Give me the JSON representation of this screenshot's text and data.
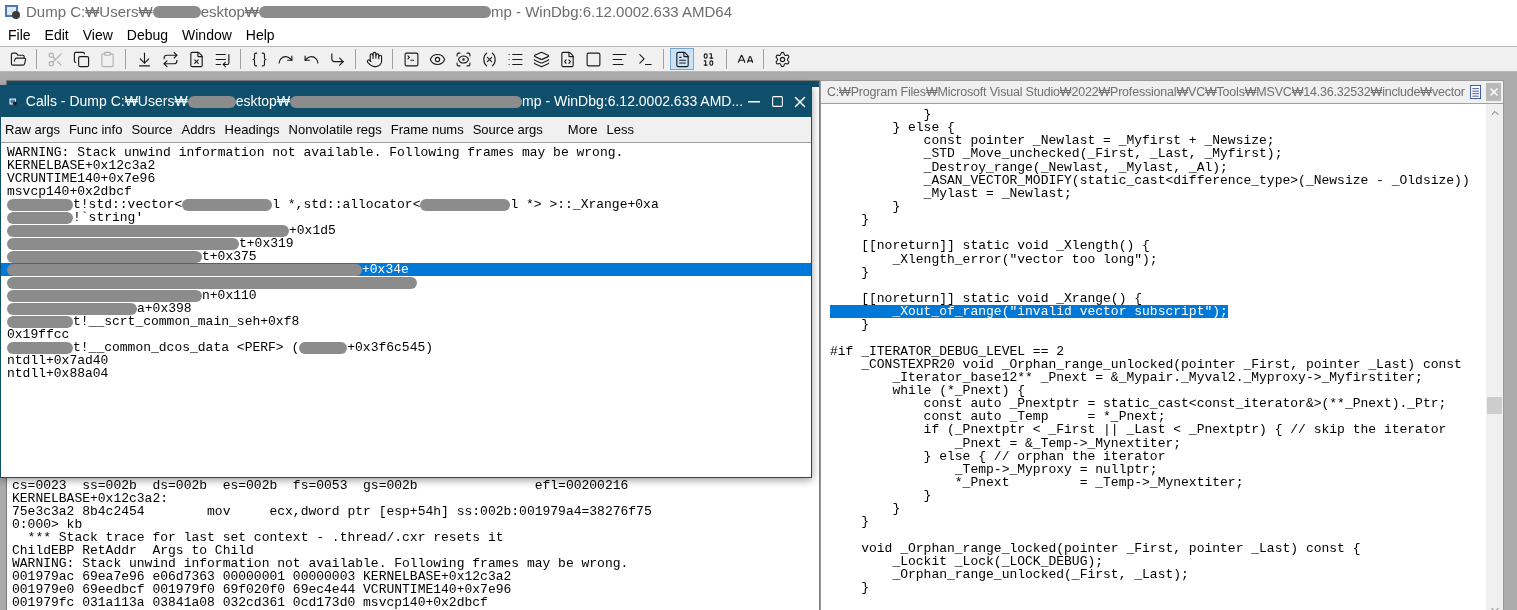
{
  "window": {
    "title": [
      {
        "kind": "text",
        "text": "Dump C:₩Users₩"
      },
      {
        "kind": "redacted"
      },
      {
        "kind": "text",
        "text": "esktop₩"
      },
      {
        "kind": "redacted"
      },
      {
        "kind": "text",
        "text": "mp - WinDbg:6.12.0002.633 AMD64"
      }
    ]
  },
  "menu": [
    "File",
    "Edit",
    "View",
    "Debug",
    "Window",
    "Help"
  ],
  "toolbar": [
    {
      "pressed": false,
      "disabled": false
    },
    {
      "pressed": false,
      "disabled": true
    },
    {
      "pressed": false,
      "disabled": false
    },
    {
      "pressed": false,
      "disabled": true
    },
    {
      "pressed": false,
      "disabled": false
    },
    {
      "pressed": false,
      "disabled": false
    },
    {
      "pressed": false,
      "disabled": false
    },
    {
      "pressed": false,
      "disabled": false
    },
    {
      "pressed": false,
      "disabled": false
    },
    {
      "pressed": false,
      "disabled": false
    },
    {
      "pressed": false,
      "disabled": false
    },
    {
      "pressed": false,
      "disabled": false
    },
    {
      "pressed": false,
      "disabled": false
    },
    {
      "pressed": false,
      "disabled": false
    },
    {
      "pressed": false,
      "disabled": false
    },
    {
      "pressed": false,
      "disabled": false
    },
    {
      "pressed": false,
      "disabled": false
    },
    {
      "pressed": false,
      "disabled": false
    },
    {
      "pressed": false,
      "disabled": false
    },
    {
      "pressed": false,
      "disabled": false
    },
    {
      "pressed": false,
      "disabled": false
    },
    {
      "pressed": false,
      "disabled": false
    },
    {
      "pressed": false,
      "disabled": false
    },
    {
      "pressed": true,
      "disabled": false
    },
    {
      "pressed": false,
      "disabled": false
    },
    {
      "pressed": false,
      "disabled": false
    },
    {
      "pressed": false,
      "disabled": false
    }
  ],
  "command_window": {
    "lines": [
      "cs=0023  ss=002b  ds=002b  es=002b  fs=0053  gs=002b               efl=00200216",
      "KERNELBASE+0x12c3a2:",
      "75e3c3a2 8b4c2454        mov     ecx,dword ptr [esp+54h] ss:002b:001979a4=38276f75",
      "0:000> kb",
      "  *** Stack trace for last set context - .thread/.cxr resets it",
      "ChildEBP RetAddr  Args to Child",
      "WARNING: Stack unwind information not available. Following frames may be wrong.",
      "001979ac 69ea7e96 e06d7363 00000001 00000003 KERNELBASE+0x12c3a2",
      "001979e0 69eedbcf 001979f0 69f020f0 69ec4e44 VCRUNTIME140+0x7e96",
      "001979fc 031a113a 03841a08 032cd361 0cd173d0 msvcp140+0x2dbcf"
    ]
  },
  "calls_window": {
    "title": [
      {
        "kind": "text",
        "text": "Calls - Dump C:₩Users₩"
      },
      {
        "kind": "redacted"
      },
      {
        "kind": "text",
        "text": "esktop₩"
      },
      {
        "kind": "redacted"
      },
      {
        "kind": "text",
        "text": "mp - WinDbg:6.12.0002.633 AMD..."
      }
    ],
    "options": [
      "Raw args",
      "Func info",
      "Source",
      "Addrs",
      "Headings",
      "Nonvolatile regs",
      "Frame nums",
      "Source args",
      "More",
      "Less"
    ],
    "frames": [
      {
        "selected": false,
        "segments": [
          {
            "kind": "text",
            "text": "WARNING: Stack unwind information not available. Following frames may be wrong."
          }
        ]
      },
      {
        "selected": false,
        "segments": [
          {
            "kind": "text",
            "text": "KERNELBASE+0x12c3a2"
          }
        ]
      },
      {
        "selected": false,
        "segments": [
          {
            "kind": "text",
            "text": "VCRUNTIME140+0x7e96"
          }
        ]
      },
      {
        "selected": false,
        "segments": [
          {
            "kind": "text",
            "text": "msvcp140+0x2dbcf"
          }
        ]
      },
      {
        "selected": false,
        "segments": [
          {
            "kind": "redacted"
          },
          {
            "kind": "text",
            "text": "t!std::vector<"
          },
          {
            "kind": "redacted"
          },
          {
            "kind": "text",
            "text": "l *,std::allocator<"
          },
          {
            "kind": "redacted"
          },
          {
            "kind": "text",
            "text": "l *> >::_Xrange+0xa"
          }
        ]
      },
      {
        "selected": false,
        "segments": [
          {
            "kind": "redacted"
          },
          {
            "kind": "text",
            "text": "!`string'"
          }
        ]
      },
      {
        "selected": false,
        "segments": [
          {
            "kind": "redacted"
          },
          {
            "kind": "text",
            "text": "+0x1d5"
          }
        ]
      },
      {
        "selected": false,
        "segments": [
          {
            "kind": "redacted"
          },
          {
            "kind": "text",
            "text": "t+0x319"
          }
        ]
      },
      {
        "selected": false,
        "segments": [
          {
            "kind": "redacted"
          },
          {
            "kind": "text",
            "text": "t+0x375"
          }
        ]
      },
      {
        "selected": true,
        "segments": [
          {
            "kind": "redacted"
          },
          {
            "kind": "text",
            "text": "+0x34e"
          }
        ]
      },
      {
        "selected": false,
        "segments": [
          {
            "kind": "redacted"
          }
        ]
      },
      {
        "selected": false,
        "segments": [
          {
            "kind": "redacted"
          },
          {
            "kind": "text",
            "text": "n+0x110"
          }
        ]
      },
      {
        "selected": false,
        "segments": [
          {
            "kind": "redacted"
          },
          {
            "kind": "text",
            "text": "a+0x398"
          }
        ]
      },
      {
        "selected": false,
        "segments": [
          {
            "kind": "redacted"
          },
          {
            "kind": "text",
            "text": "t!__scrt_common_main_seh+0xf8"
          }
        ]
      },
      {
        "selected": false,
        "segments": [
          {
            "kind": "text",
            "text": "0x19ffcc"
          }
        ]
      },
      {
        "selected": false,
        "segments": [
          {
            "kind": "redacted"
          },
          {
            "kind": "text",
            "text": "t!__common_dcos_data <PERF> ("
          },
          {
            "kind": "redacted"
          },
          {
            "kind": "text",
            "text": "+0x3f6c545)"
          }
        ]
      },
      {
        "selected": false,
        "segments": [
          {
            "kind": "text",
            "text": "ntdll+0x7ad40"
          }
        ]
      },
      {
        "selected": false,
        "segments": [
          {
            "kind": "text",
            "text": "ntdll+0x88a04"
          }
        ]
      }
    ]
  },
  "source_window": {
    "title": "C:₩Program Files₩Microsoft Visual Studio₩2022₩Professional₩VC₩Tools₩MSVC₩14.36.32532₩include₩vector",
    "lines": [
      {
        "kind": "code",
        "selected": false,
        "text": "            }"
      },
      {
        "kind": "code",
        "selected": false,
        "text": "        } else {"
      },
      {
        "kind": "code",
        "selected": false,
        "text": "            const pointer _Newlast = _Myfirst + _Newsize;"
      },
      {
        "kind": "code",
        "selected": false,
        "text": "            _STD _Move_unchecked(_First, _Last, _Myfirst);"
      },
      {
        "kind": "code",
        "selected": false,
        "text": "            _Destroy_range(_Newlast, _Mylast, _Al);"
      },
      {
        "kind": "code",
        "selected": false,
        "text": "            _ASAN_VECTOR_MODIFY(static_cast<difference_type>(_Newsize - _Oldsize))"
      },
      {
        "kind": "code",
        "selected": false,
        "text": "            _Mylast = _Newlast;"
      },
      {
        "kind": "code",
        "selected": false,
        "text": "        }"
      },
      {
        "kind": "code",
        "selected": false,
        "text": "    }"
      },
      {
        "kind": "blank",
        "selected": false
      },
      {
        "kind": "code",
        "selected": false,
        "text": "    [[noreturn]] static void _Xlength() {"
      },
      {
        "kind": "code",
        "selected": false,
        "text": "        _Xlength_error(\"vector too long\");"
      },
      {
        "kind": "code",
        "selected": false,
        "text": "    }"
      },
      {
        "kind": "blank",
        "selected": false
      },
      {
        "kind": "code",
        "selected": false,
        "text": "    [[noreturn]] static void _Xrange() {"
      },
      {
        "kind": "code",
        "selected": true,
        "text": "        _Xout_of_range(\"invalid vector subscript\");"
      },
      {
        "kind": "code",
        "selected": false,
        "text": "    }"
      },
      {
        "kind": "blank",
        "selected": false
      },
      {
        "kind": "code",
        "selected": false,
        "text": "#if _ITERATOR_DEBUG_LEVEL == 2"
      },
      {
        "kind": "code",
        "selected": false,
        "text": "    _CONSTEXPR20 void _Orphan_range_unlocked(pointer _First, pointer _Last) const"
      },
      {
        "kind": "code",
        "selected": false,
        "text": "        _Iterator_base12** _Pnext = &_Mypair._Myval2._Myproxy->_Myfirstiter;"
      },
      {
        "kind": "code",
        "selected": false,
        "text": "        while (*_Pnext) {"
      },
      {
        "kind": "code",
        "selected": false,
        "text": "            const auto _Pnextptr = static_cast<const_iterator&>(**_Pnext)._Ptr;"
      },
      {
        "kind": "code",
        "selected": false,
        "text": "            const auto _Temp     = *_Pnext;"
      },
      {
        "kind": "code",
        "selected": false,
        "text": "            if (_Pnextptr < _First || _Last < _Pnextptr) { // skip the iterator"
      },
      {
        "kind": "code",
        "selected": false,
        "text": "                _Pnext = &_Temp->_Mynextiter;"
      },
      {
        "kind": "code",
        "selected": false,
        "text": "            } else { // orphan the iterator"
      },
      {
        "kind": "code",
        "selected": false,
        "text": "                _Temp->_Myproxy = nullptr;"
      },
      {
        "kind": "code",
        "selected": false,
        "text": "                *_Pnext         = _Temp->_Mynextiter;"
      },
      {
        "kind": "code",
        "selected": false,
        "text": "            }"
      },
      {
        "kind": "code",
        "selected": false,
        "text": "        }"
      },
      {
        "kind": "code",
        "selected": false,
        "text": "    }"
      },
      {
        "kind": "blank",
        "selected": false
      },
      {
        "kind": "code",
        "selected": false,
        "text": "    void _Orphan_range_locked(pointer _First, pointer _Last) const {"
      },
      {
        "kind": "code",
        "selected": false,
        "text": "        _Lockit _Lock(_LOCK_DEBUG);"
      },
      {
        "kind": "code",
        "selected": false,
        "text": "        _Orphan_range_unlocked(_First, _Last);"
      },
      {
        "kind": "code",
        "selected": false,
        "text": "    }"
      }
    ]
  }
}
